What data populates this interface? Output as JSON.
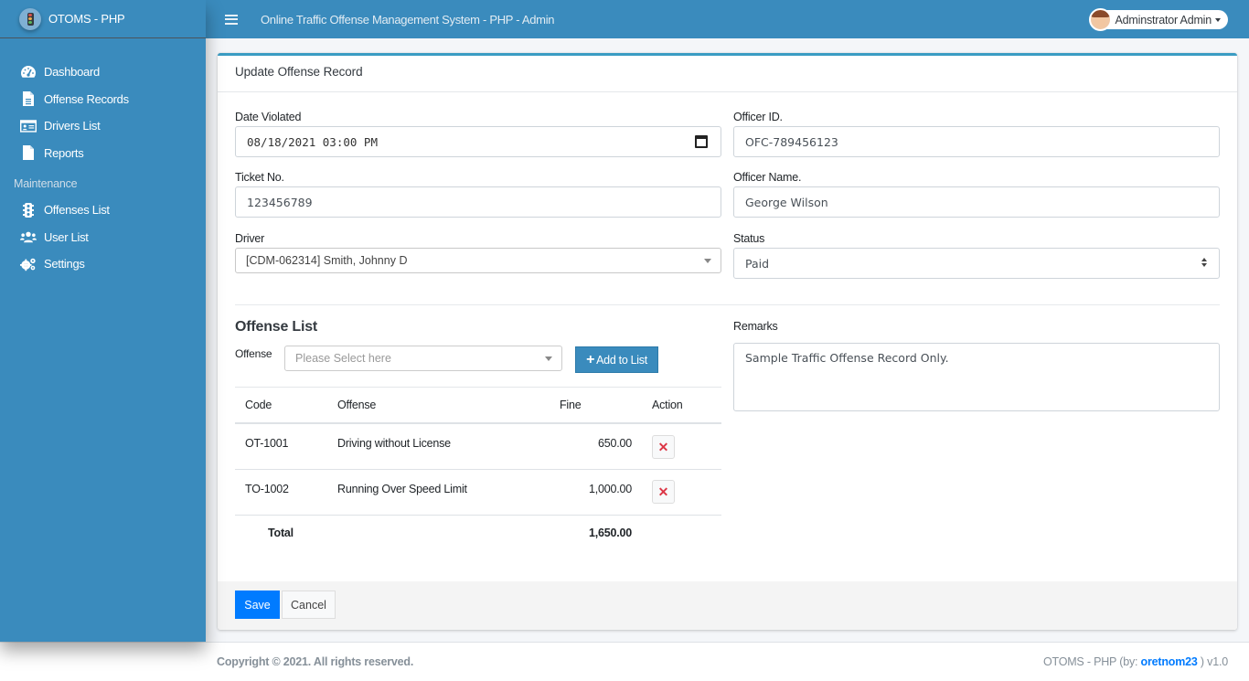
{
  "brand": {
    "name": "OTOMS - PHP",
    "logo_icon": "traffic-light-icon"
  },
  "topbar": {
    "title": "Online Traffic Offense Management System - PHP - Admin",
    "user_name": "Adminstrator Admin",
    "menu_icon": "hamburger-icon"
  },
  "sidebar": {
    "items": [
      {
        "label": "Dashboard",
        "icon": "tachometer-icon"
      },
      {
        "label": "Offense Records",
        "icon": "file-alt-icon"
      },
      {
        "label": "Drivers List",
        "icon": "id-card-icon"
      },
      {
        "label": "Reports",
        "icon": "file-icon"
      }
    ],
    "section_header": "Maintenance",
    "maintenance_items": [
      {
        "label": "Offenses List",
        "icon": "traffic-light-icon"
      },
      {
        "label": "User List",
        "icon": "users-icon"
      },
      {
        "label": "Settings",
        "icon": "cogs-icon"
      }
    ]
  },
  "card": {
    "title": "Update Offense Record",
    "fields": {
      "date_violated": {
        "label": "Date Violated",
        "value": "08/18/2021 03:00 PM"
      },
      "ticket_no": {
        "label": "Ticket No.",
        "value": "123456789"
      },
      "driver": {
        "label": "Driver",
        "value": "[CDM-062314] Smith, Johnny D"
      },
      "officer_id": {
        "label": "Officer ID.",
        "value": "OFC-789456123"
      },
      "officer_name": {
        "label": "Officer Name.",
        "value": "George Wilson"
      },
      "status": {
        "label": "Status",
        "value": "Paid"
      },
      "remarks": {
        "label": "Remarks",
        "value": "Sample Traffic Offense Record Only."
      }
    },
    "offense_list": {
      "title": "Offense List",
      "offense_label": "Offense",
      "offense_placeholder": "Please Select here",
      "add_button": "Add to List",
      "columns": [
        "Code",
        "Offense",
        "Fine",
        "Action"
      ],
      "rows": [
        {
          "code": "OT-1001",
          "offense": "Driving without License",
          "fine": "650.00"
        },
        {
          "code": "TO-1002",
          "offense": "Running Over Speed Limit",
          "fine": "1,000.00"
        }
      ],
      "total_label": "Total",
      "total_value": "1,650.00"
    },
    "buttons": {
      "save": "Save",
      "cancel": "Cancel"
    }
  },
  "footer": {
    "copyright": "Copyright © 2021. All rights reserved.",
    "credits_prefix": "OTOMS - PHP (by: ",
    "credits_author": "oretnom23",
    "credits_suffix": " ) v1.0"
  },
  "colors": {
    "primary": "#3a8bbd",
    "save": "#007bff",
    "danger": "#dc3545",
    "card_accent": "#3a9cc3"
  }
}
